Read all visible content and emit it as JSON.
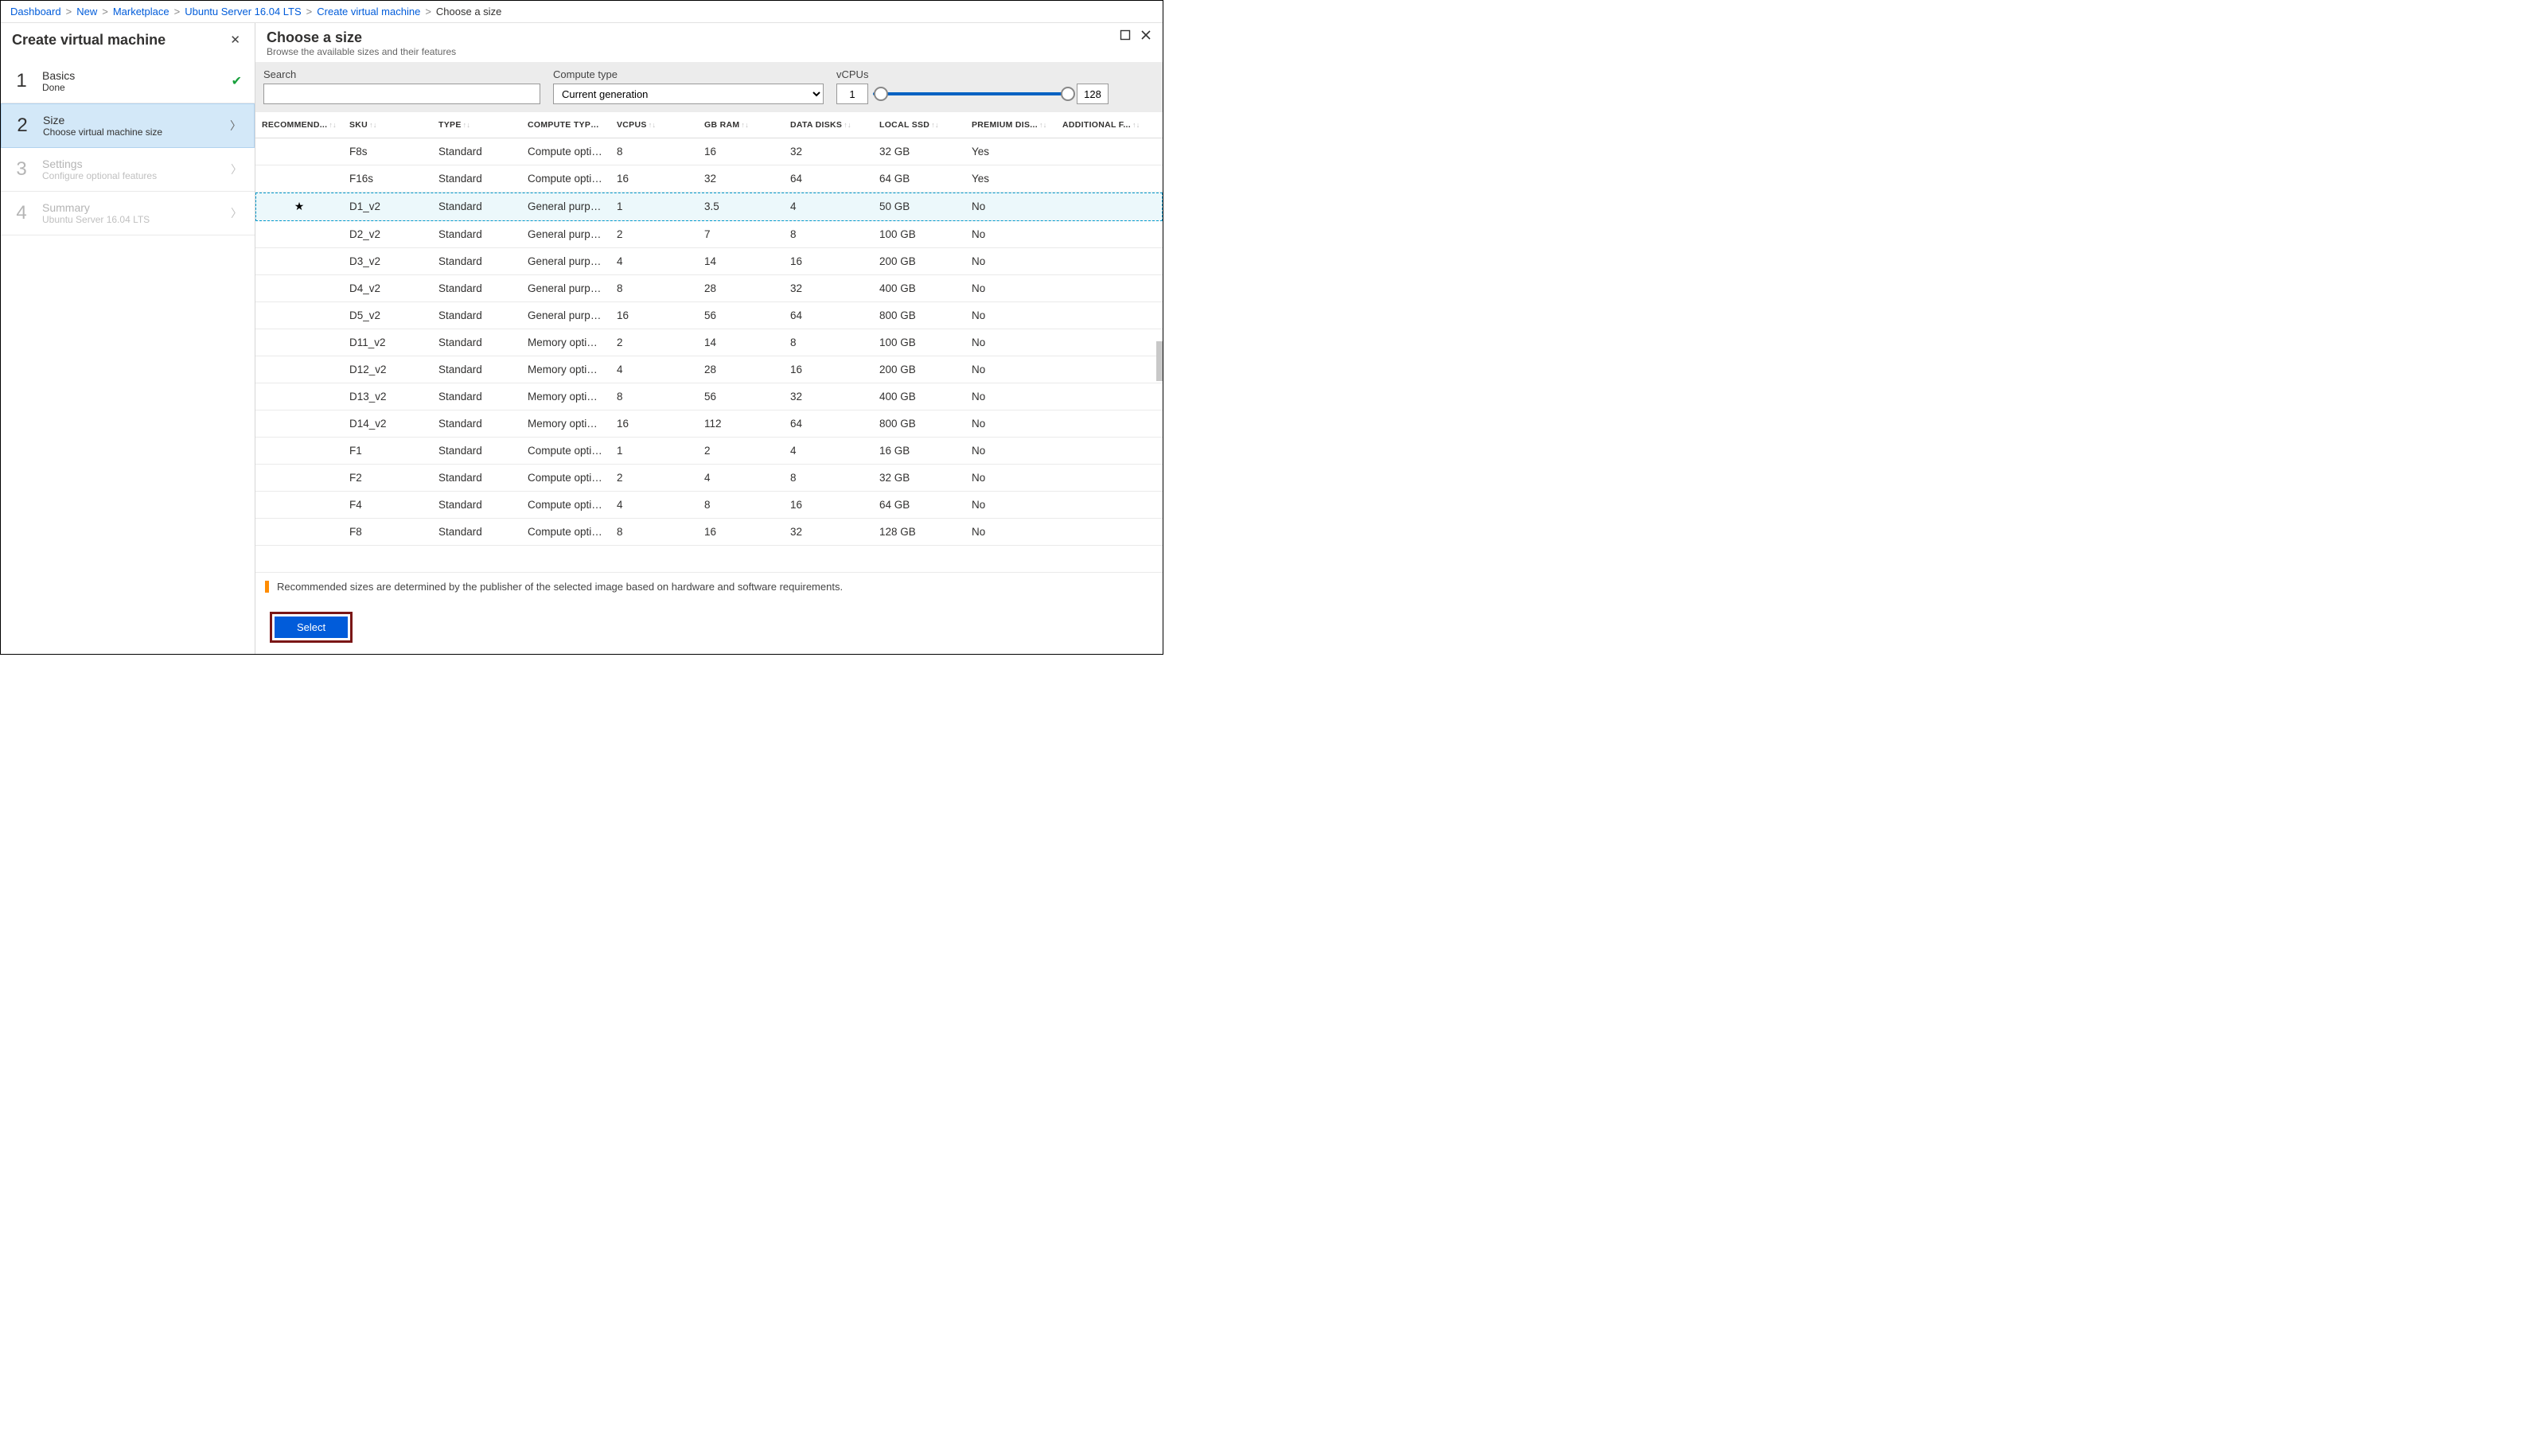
{
  "breadcrumbs": [
    {
      "label": "Dashboard",
      "link": true
    },
    {
      "label": "New",
      "link": true
    },
    {
      "label": "Marketplace",
      "link": true
    },
    {
      "label": "Ubuntu Server 16.04 LTS",
      "link": true
    },
    {
      "label": "Create virtual machine",
      "link": true
    },
    {
      "label": "Choose a size",
      "link": false
    }
  ],
  "left": {
    "title": "Create virtual machine",
    "steps": [
      {
        "num": "1",
        "title": "Basics",
        "sub": "Done",
        "state": "done"
      },
      {
        "num": "2",
        "title": "Size",
        "sub": "Choose virtual machine size",
        "state": "active"
      },
      {
        "num": "3",
        "title": "Settings",
        "sub": "Configure optional features",
        "state": "disabled"
      },
      {
        "num": "4",
        "title": "Summary",
        "sub": "Ubuntu Server 16.04 LTS",
        "state": "disabled"
      }
    ]
  },
  "right": {
    "title": "Choose a size",
    "subtitle": "Browse the available sizes and their features",
    "filters": {
      "search_label": "Search",
      "search_value": "",
      "compute_label": "Compute type",
      "compute_value": "Current generation",
      "vcpus_label": "vCPUs",
      "vcpus_min": "1",
      "vcpus_max": "128"
    },
    "columns": [
      "RECOMMEND...",
      "SKU",
      "TYPE",
      "COMPUTE TYPE",
      "VCPUS",
      "GB RAM",
      "DATA DISKS",
      "LOCAL SSD",
      "PREMIUM DIS...",
      "ADDITIONAL F..."
    ],
    "rows": [
      {
        "rec": "",
        "sku": "F8s",
        "type": "Standard",
        "ctype": "Compute optimiz",
        "vcpus": "8",
        "ram": "16",
        "disks": "32",
        "ssd": "32 GB",
        "prem": "Yes",
        "sel": false
      },
      {
        "rec": "",
        "sku": "F16s",
        "type": "Standard",
        "ctype": "Compute optimiz",
        "vcpus": "16",
        "ram": "32",
        "disks": "64",
        "ssd": "64 GB",
        "prem": "Yes",
        "sel": false
      },
      {
        "rec": "★",
        "sku": "D1_v2",
        "type": "Standard",
        "ctype": "General purpose",
        "vcpus": "1",
        "ram": "3.5",
        "disks": "4",
        "ssd": "50 GB",
        "prem": "No",
        "sel": true
      },
      {
        "rec": "",
        "sku": "D2_v2",
        "type": "Standard",
        "ctype": "General purpose",
        "vcpus": "2",
        "ram": "7",
        "disks": "8",
        "ssd": "100 GB",
        "prem": "No",
        "sel": false
      },
      {
        "rec": "",
        "sku": "D3_v2",
        "type": "Standard",
        "ctype": "General purpose",
        "vcpus": "4",
        "ram": "14",
        "disks": "16",
        "ssd": "200 GB",
        "prem": "No",
        "sel": false
      },
      {
        "rec": "",
        "sku": "D4_v2",
        "type": "Standard",
        "ctype": "General purpose",
        "vcpus": "8",
        "ram": "28",
        "disks": "32",
        "ssd": "400 GB",
        "prem": "No",
        "sel": false
      },
      {
        "rec": "",
        "sku": "D5_v2",
        "type": "Standard",
        "ctype": "General purpose",
        "vcpus": "16",
        "ram": "56",
        "disks": "64",
        "ssd": "800 GB",
        "prem": "No",
        "sel": false
      },
      {
        "rec": "",
        "sku": "D11_v2",
        "type": "Standard",
        "ctype": "Memory optimize",
        "vcpus": "2",
        "ram": "14",
        "disks": "8",
        "ssd": "100 GB",
        "prem": "No",
        "sel": false
      },
      {
        "rec": "",
        "sku": "D12_v2",
        "type": "Standard",
        "ctype": "Memory optimize",
        "vcpus": "4",
        "ram": "28",
        "disks": "16",
        "ssd": "200 GB",
        "prem": "No",
        "sel": false
      },
      {
        "rec": "",
        "sku": "D13_v2",
        "type": "Standard",
        "ctype": "Memory optimize",
        "vcpus": "8",
        "ram": "56",
        "disks": "32",
        "ssd": "400 GB",
        "prem": "No",
        "sel": false
      },
      {
        "rec": "",
        "sku": "D14_v2",
        "type": "Standard",
        "ctype": "Memory optimize",
        "vcpus": "16",
        "ram": "112",
        "disks": "64",
        "ssd": "800 GB",
        "prem": "No",
        "sel": false
      },
      {
        "rec": "",
        "sku": "F1",
        "type": "Standard",
        "ctype": "Compute optimiz",
        "vcpus": "1",
        "ram": "2",
        "disks": "4",
        "ssd": "16 GB",
        "prem": "No",
        "sel": false
      },
      {
        "rec": "",
        "sku": "F2",
        "type": "Standard",
        "ctype": "Compute optimiz",
        "vcpus": "2",
        "ram": "4",
        "disks": "8",
        "ssd": "32 GB",
        "prem": "No",
        "sel": false
      },
      {
        "rec": "",
        "sku": "F4",
        "type": "Standard",
        "ctype": "Compute optimiz",
        "vcpus": "4",
        "ram": "8",
        "disks": "16",
        "ssd": "64 GB",
        "prem": "No",
        "sel": false
      },
      {
        "rec": "",
        "sku": "F8",
        "type": "Standard",
        "ctype": "Compute optimiz",
        "vcpus": "8",
        "ram": "16",
        "disks": "32",
        "ssd": "128 GB",
        "prem": "No",
        "sel": false
      }
    ],
    "info": "Recommended sizes are determined by the publisher of the selected image based on hardware and software requirements.",
    "select_label": "Select"
  }
}
